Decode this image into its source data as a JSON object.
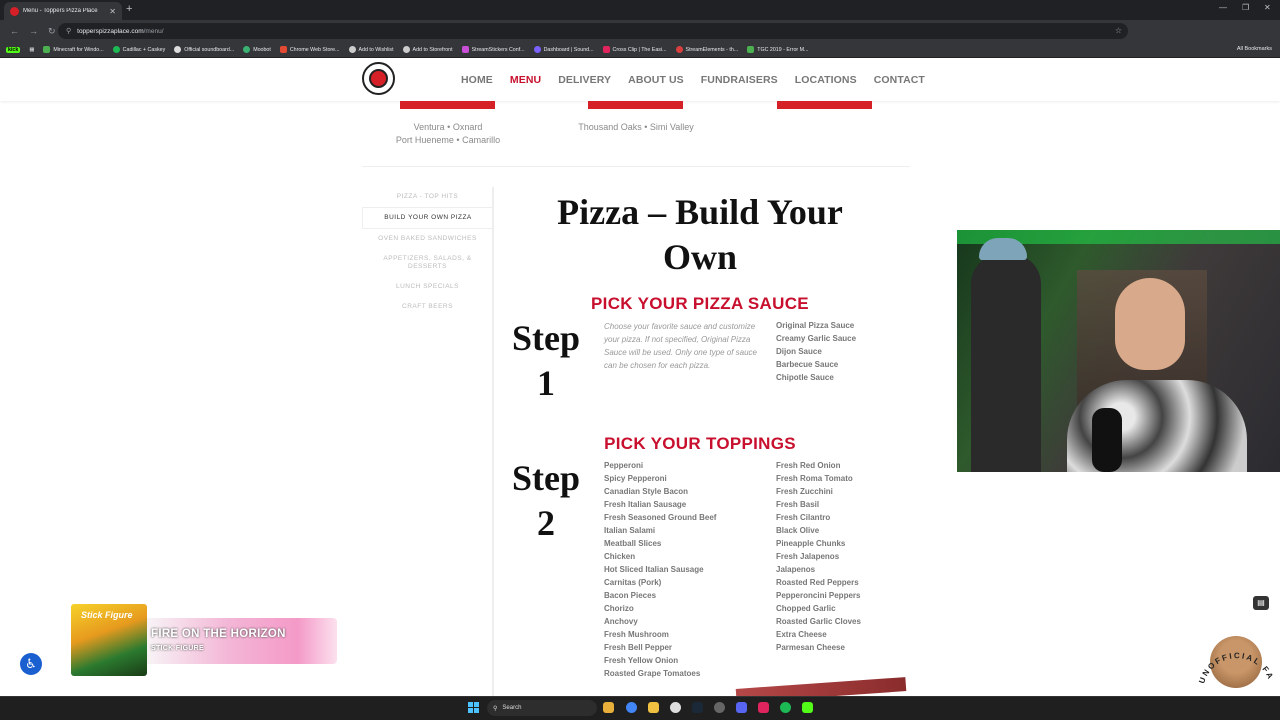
{
  "browser": {
    "tab_title": "Menu - Toppers Pizza Place",
    "url_host": "topperspizzaplace.com",
    "url_path": "/menu/",
    "bookmarks": [
      "Minecraft for Windo...",
      "Cadillac + Caskey",
      "Official soundboard...",
      "Moobot",
      "Chrome Web Store...",
      "Add to Wishlist",
      "Add to Storefront",
      "StreamStickers Conf...",
      "Dashboard | Sound...",
      "Cross Clip | The Easi...",
      "StreamElements - th...",
      "TGC 2019 - Error M..."
    ],
    "all_bookmarks": "All Bookmarks",
    "kick": "kick"
  },
  "nav": {
    "items": [
      "HOME",
      "MENU",
      "DELIVERY",
      "ABOUT US",
      "FUNDRAISERS",
      "LOCATIONS",
      "CONTACT"
    ],
    "active": "MENU"
  },
  "locations": {
    "left_line1": "Ventura • Oxnard",
    "left_line2": "Port Hueneme • Camarillo",
    "center": "Thousand Oaks • Simi Valley"
  },
  "sidebar": [
    "PIZZA - TOP HITS",
    "BUILD YOUR OWN PIZZA",
    "OVEN BAKED SANDWICHES",
    "APPETIZERS, SALADS, & DESSERTS",
    "LUNCH SPECIALS",
    "CRAFT BEERS"
  ],
  "sidebar_selected": "BUILD YOUR OWN PIZZA",
  "main": {
    "title_line1": "Pizza – Build Your",
    "title_line2": "Own",
    "sauce_heading": "PICK YOUR PIZZA SAUCE",
    "step1_word": "Step",
    "step1_num": "1",
    "sauce_desc": "Choose your favorite sauce and customize your pizza. If not specified, Original Pizza Sauce will be used. Only one type of sauce can be chosen for each pizza.",
    "sauces": [
      "Original Pizza Sauce",
      "Creamy Garlic Sauce",
      "Dijon Sauce",
      "Barbecue Sauce",
      "Chipotle Sauce"
    ],
    "toppings_heading": "PICK YOUR TOPPINGS",
    "step2_word": "Step",
    "step2_num": "2",
    "toppings_col1": [
      "Pepperoni",
      "Spicy Pepperoni",
      "Canadian Style Bacon",
      "Fresh Italian Sausage",
      "Fresh Seasoned Ground Beef",
      "Italian Salami",
      "Meatball Slices",
      "Chicken",
      "Hot Sliced Italian Sausage",
      "Carnitas (Pork)",
      "Bacon Pieces",
      "Chorizo",
      "Anchovy",
      "Fresh Mushroom",
      "Fresh Bell Pepper",
      "Fresh Yellow Onion",
      "Roasted Grape Tomatoes"
    ],
    "toppings_col2": [
      "Fresh Red Onion",
      "Fresh Roma Tomato",
      "Fresh Zucchini",
      "Fresh Basil",
      "Fresh Cilantro",
      "Black Olive",
      "Pineapple Chunks",
      "Fresh Jalapenos",
      "Jalapenos",
      "Roasted Red Peppers",
      "Pepperoncini Peppers",
      "Chopped Garlic",
      "Roasted Garlic Cloves",
      "Extra Cheese",
      "Parmesan Cheese"
    ]
  },
  "now_playing": {
    "song": "FIRE ON THE HORIZON",
    "artist": "STICK FIGURE",
    "album_art_text": "Stick Figure"
  },
  "badge_text": "UNOFFICIAL FAMILY",
  "taskbar": {
    "search": "Search"
  },
  "colors": {
    "brand_red": "#c8102e",
    "accent_green": "#1fd14a"
  }
}
